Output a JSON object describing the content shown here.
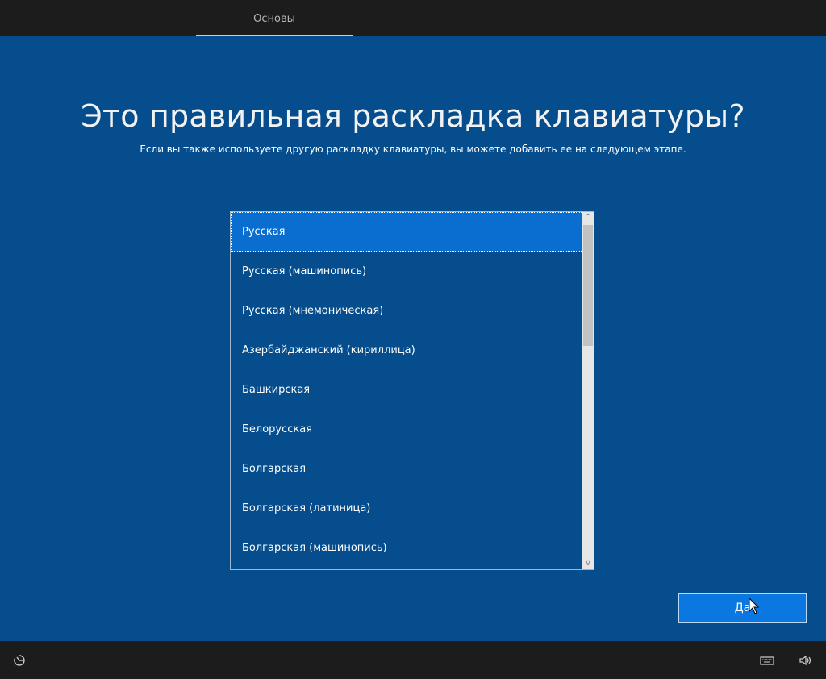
{
  "topbar": {
    "tab_label": "Основы"
  },
  "page": {
    "title": "Это правильная раскладка клавиатуры?",
    "subtitle": "Если вы также используете другую раскладку клавиатуры, вы можете добавить ее на следующем этапе."
  },
  "layouts": {
    "selected": "Русская",
    "items": [
      "Русская",
      "Русская (машинопись)",
      "Русская (мнемоническая)",
      "Азербайджанский (кириллица)",
      "Башкирская",
      "Белорусская",
      "Болгарская",
      "Болгарская (латиница)",
      "Болгарская (машинопись)"
    ]
  },
  "actions": {
    "yes_label": "Да"
  },
  "taskbar": {
    "left_icons": [
      "accessibility-icon"
    ],
    "right_icons": [
      "keyboard-icon",
      "volume-icon"
    ]
  },
  "colors": {
    "panel_bg": "#054d8c",
    "selection": "#0a6ed1",
    "button": "#0a78e0",
    "bar_bg": "#1c1c1c"
  }
}
